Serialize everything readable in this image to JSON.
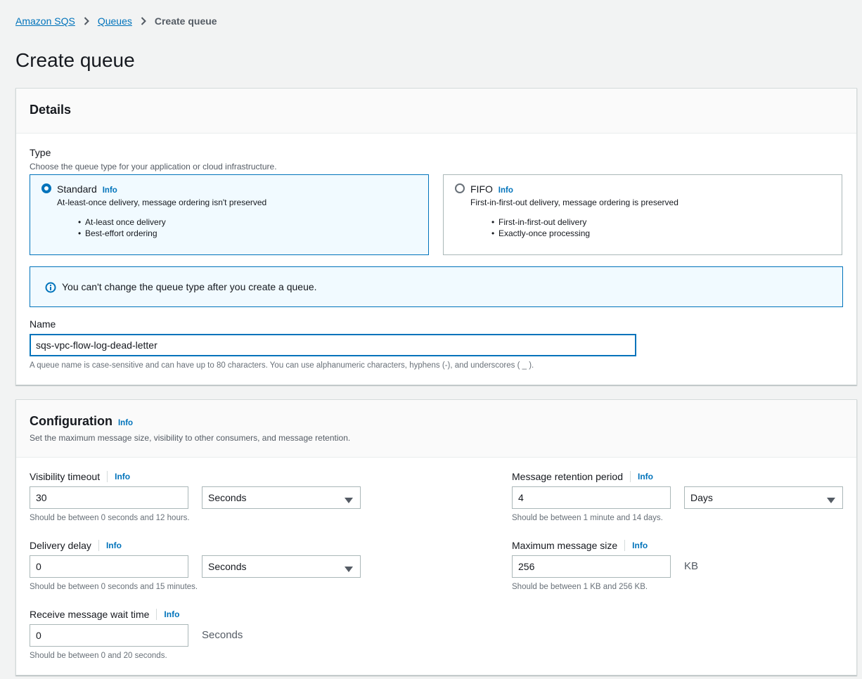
{
  "breadcrumb": {
    "items": [
      {
        "label": "Amazon SQS"
      },
      {
        "label": "Queues"
      }
    ],
    "current": "Create queue"
  },
  "page": {
    "title": "Create queue"
  },
  "details": {
    "title": "Details",
    "type": {
      "label": "Type",
      "description": "Choose the queue type for your application or cloud infrastructure.",
      "selected": "Standard",
      "options": [
        {
          "title": "Standard",
          "info": "Info",
          "description": "At-least-once delivery, message ordering isn't preserved",
          "bullets": [
            "At-least once delivery",
            "Best-effort ordering"
          ]
        },
        {
          "title": "FIFO",
          "info": "Info",
          "description": "First-in-first-out delivery, message ordering is preserved",
          "bullets": [
            "First-in-first-out delivery",
            "Exactly-once processing"
          ]
        }
      ]
    },
    "alert": {
      "text": "You can't change the queue type after you create a queue.",
      "icon": "info-circle-icon"
    },
    "name": {
      "label": "Name",
      "value": "sqs-vpc-flow-log-dead-letter",
      "hint": "A queue name is case-sensitive and can have up to 80 characters. You can use alphanumeric characters, hyphens (-), and underscores ( _ )."
    }
  },
  "configuration": {
    "title": "Configuration",
    "info": "Info",
    "description": "Set the maximum message size, visibility to other consumers, and message retention.",
    "visibility_timeout": {
      "label": "Visibility timeout",
      "info": "Info",
      "value": "30",
      "unit": "Seconds",
      "hint": "Should be between 0 seconds and 12 hours."
    },
    "message_retention": {
      "label": "Message retention period",
      "info": "Info",
      "value": "4",
      "unit": "Days",
      "hint": "Should be between 1 minute and 14 days."
    },
    "delivery_delay": {
      "label": "Delivery delay",
      "info": "Info",
      "value": "0",
      "unit": "Seconds",
      "hint": "Should be between 0 seconds and 15 minutes."
    },
    "max_message_size": {
      "label": "Maximum message size",
      "info": "Info",
      "value": "256",
      "unit": "KB",
      "hint": "Should be between 1 KB and 256 KB."
    },
    "receive_wait_time": {
      "label": "Receive message wait time",
      "info": "Info",
      "value": "0",
      "unit": "Seconds",
      "hint": "Should be between 0 and 20 seconds."
    }
  },
  "colors": {
    "accent": "#0073bb",
    "selected_bg": "#f1faff",
    "page_bg": "#f2f3f3"
  }
}
